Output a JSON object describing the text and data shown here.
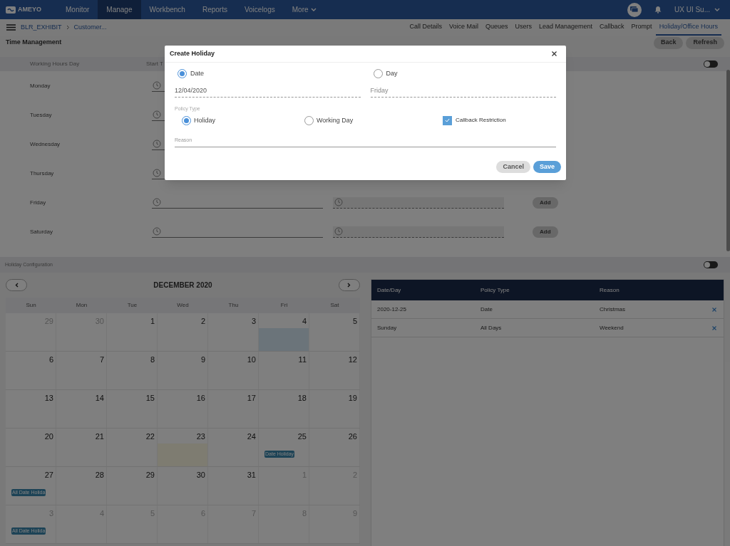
{
  "nav": {
    "logo": "AMEYO",
    "items": [
      {
        "label": "Monitor",
        "selected": false
      },
      {
        "label": "Manage",
        "selected": true
      },
      {
        "label": "Workbench",
        "selected": false
      },
      {
        "label": "Reports",
        "selected": false
      },
      {
        "label": "Voicelogs",
        "selected": false
      },
      {
        "label": "More",
        "selected": false
      }
    ],
    "user": "UX UI Su..."
  },
  "breadcrumb": [
    "BLR_EXHIBIT",
    "Customer..."
  ],
  "tabs": [
    {
      "label": "Call Details",
      "selected": false
    },
    {
      "label": "Voice Mail",
      "selected": false
    },
    {
      "label": "Queues",
      "selected": false
    },
    {
      "label": "Users",
      "selected": false
    },
    {
      "label": "Lead Management",
      "selected": false
    },
    {
      "label": "Callback",
      "selected": false
    },
    {
      "label": "Prompt",
      "selected": false
    },
    {
      "label": "Holiday/Office Hours",
      "selected": true
    }
  ],
  "page_title": "Time Management",
  "page_buttons": [
    "Back",
    "Refresh"
  ],
  "working_hours": {
    "columns": [
      "Working Hours Day",
      "Start T"
    ],
    "toggle_on": false,
    "rows": [
      {
        "day": "Monday"
      },
      {
        "day": "Tuesday"
      },
      {
        "day": "Wednesday"
      },
      {
        "day": "Thursday"
      },
      {
        "day": "Friday",
        "add": "Add"
      },
      {
        "day": "Saturday",
        "add": "Add"
      }
    ]
  },
  "holiday": {
    "title": "Holiday Configuration",
    "toggle_on": false,
    "calendar": {
      "month": "DECEMBER 2020",
      "weekdays": [
        "Sun",
        "Mon",
        "Tue",
        "Wed",
        "Thu",
        "Fri",
        "Sat"
      ],
      "weeks": [
        [
          {
            "day": "29",
            "muted": true
          },
          {
            "day": "30",
            "muted": true
          },
          {
            "day": "1",
            "muted": false
          },
          {
            "day": "2",
            "muted": false
          },
          {
            "day": "3",
            "muted": false
          },
          {
            "day": "4",
            "muted": false,
            "selected": true
          },
          {
            "day": "5",
            "muted": false
          }
        ],
        [
          {
            "day": "6",
            "muted": false
          },
          {
            "day": "7",
            "muted": false
          },
          {
            "day": "8",
            "muted": false
          },
          {
            "day": "9",
            "muted": false
          },
          {
            "day": "10",
            "muted": false
          },
          {
            "day": "11",
            "muted": false
          },
          {
            "day": "12",
            "muted": false
          }
        ],
        [
          {
            "day": "13",
            "muted": false
          },
          {
            "day": "14",
            "muted": false
          },
          {
            "day": "15",
            "muted": false
          },
          {
            "day": "16",
            "muted": false
          },
          {
            "day": "17",
            "muted": false
          },
          {
            "day": "18",
            "muted": false
          },
          {
            "day": "19",
            "muted": false
          }
        ],
        [
          {
            "day": "20",
            "muted": false
          },
          {
            "day": "21",
            "muted": false
          },
          {
            "day": "22",
            "muted": false
          },
          {
            "day": "23",
            "muted": false,
            "today": true
          },
          {
            "day": "24",
            "muted": false
          },
          {
            "day": "25",
            "muted": false,
            "events": [
              "Date Holiday"
            ]
          },
          {
            "day": "26",
            "muted": false
          }
        ],
        [
          {
            "day": "27",
            "muted": false,
            "events": [
              "All Date Holida"
            ]
          },
          {
            "day": "28",
            "muted": false
          },
          {
            "day": "29",
            "muted": false
          },
          {
            "day": "30",
            "muted": false
          },
          {
            "day": "31",
            "muted": false
          },
          {
            "day": "1",
            "muted": true
          },
          {
            "day": "2",
            "muted": true
          }
        ],
        [
          {
            "day": "3",
            "muted": true,
            "events": [
              "All Date Holida"
            ]
          },
          {
            "day": "4",
            "muted": true
          },
          {
            "day": "5",
            "muted": true
          },
          {
            "day": "6",
            "muted": true
          },
          {
            "day": "7",
            "muted": true
          },
          {
            "day": "8",
            "muted": true
          },
          {
            "day": "9",
            "muted": true
          }
        ]
      ]
    },
    "table": {
      "columns": [
        "Date/Day",
        "Policy Type",
        "Reason"
      ],
      "rows": [
        {
          "date": "2020-12-25",
          "policy": "Date",
          "reason": "Christmas"
        },
        {
          "date": "Sunday",
          "policy": "All Days",
          "reason": "Weekend"
        }
      ]
    }
  },
  "modal": {
    "title": "Create Holiday",
    "modes": [
      {
        "label": "Date",
        "selected": true
      },
      {
        "label": "Day",
        "selected": false
      }
    ],
    "date_value": "12/04/2020",
    "day_value": "Friday",
    "policy_label": "Policy Type",
    "policies": [
      {
        "label": "Holiday",
        "selected": true
      },
      {
        "label": "Working Day",
        "selected": false
      }
    ],
    "callback": {
      "label": "Callback Restriction",
      "checked": true
    },
    "reason_label": "Reason",
    "buttons": [
      "Cancel",
      "Save"
    ]
  }
}
